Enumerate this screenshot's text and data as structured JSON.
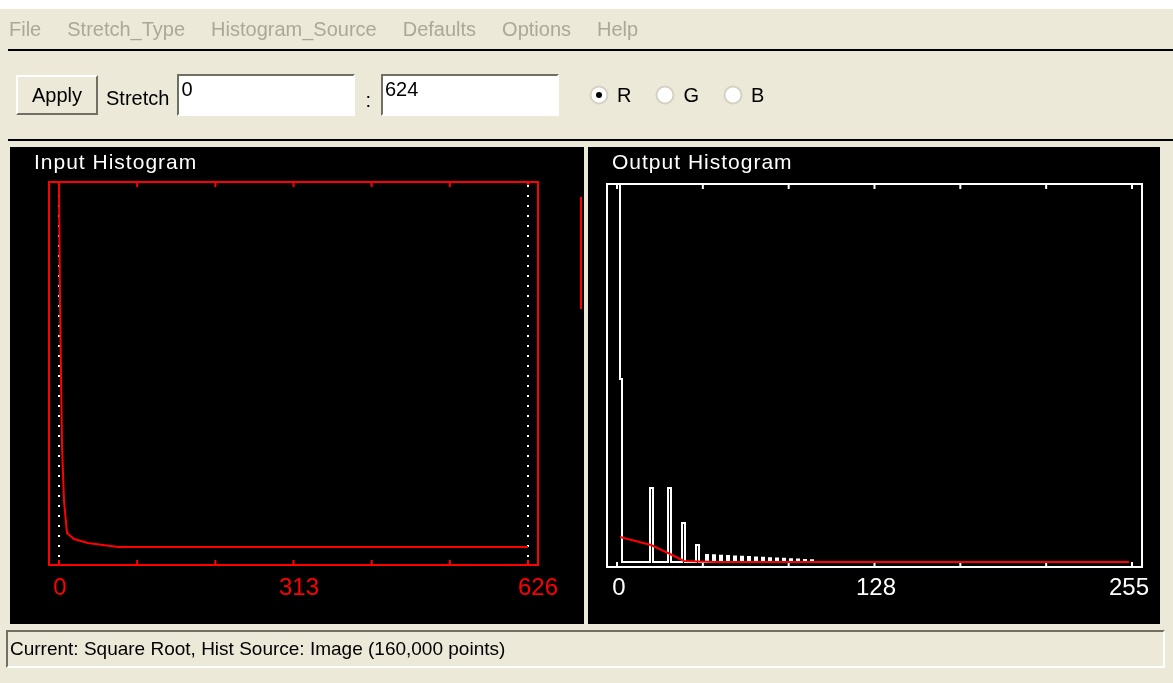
{
  "menu": [
    {
      "label": "File",
      "disabled": true
    },
    {
      "label": "Stretch_Type",
      "disabled": true
    },
    {
      "label": "Histogram_Source",
      "disabled": true
    },
    {
      "label": "Defaults",
      "disabled": true
    },
    {
      "label": "Options",
      "disabled": true
    },
    {
      "label": "Help",
      "disabled": true
    }
  ],
  "toolbar": {
    "apply_button": "Apply",
    "stretch_label": "Stretch",
    "min_value": "0",
    "separator": ":",
    "max_value": "624",
    "channels": [
      {
        "label": "R",
        "selected": true
      },
      {
        "label": "G",
        "selected": false
      },
      {
        "label": "B",
        "selected": false
      }
    ]
  },
  "panels": [
    {
      "kind": "input",
      "title": "Input Histogram",
      "tick_labels": [
        "0",
        "313",
        "626"
      ]
    },
    {
      "kind": "output",
      "title": "Output Histogram",
      "tick_labels": [
        "0",
        "128",
        "255"
      ]
    }
  ],
  "status_bar": "Current: Square Root, Hist Source: Image (160,000 points)"
}
